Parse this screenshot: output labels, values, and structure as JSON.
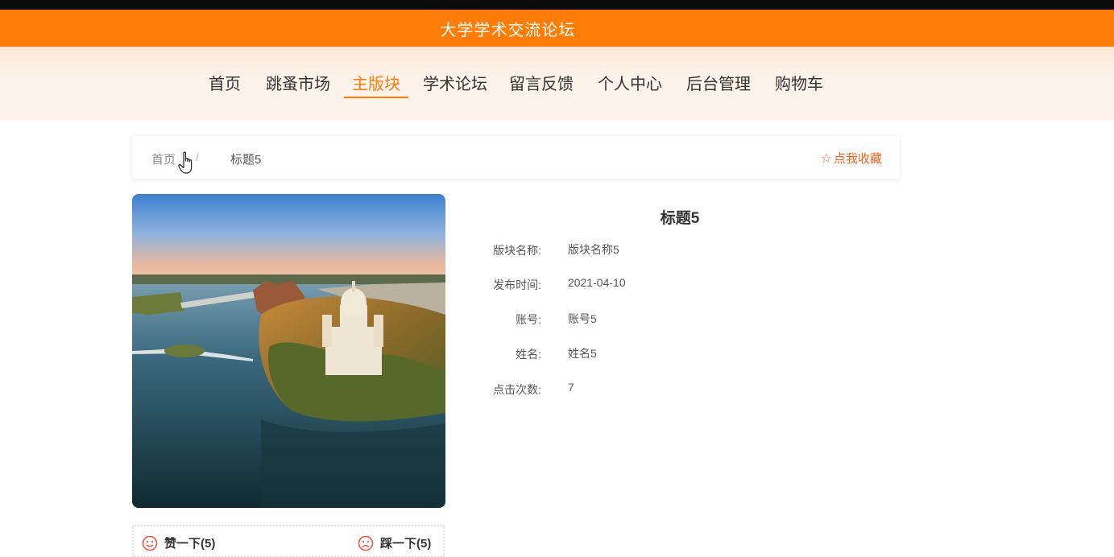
{
  "header": {
    "site_title": "大学学术交流论坛",
    "accent_color": "#ff7d06"
  },
  "nav": {
    "items": [
      {
        "label": "首页",
        "active": false
      },
      {
        "label": "跳蚤市场",
        "active": false
      },
      {
        "label": "主版块",
        "active": true
      },
      {
        "label": "学术论坛",
        "active": false
      },
      {
        "label": "留言反馈",
        "active": false
      },
      {
        "label": "个人中心",
        "active": false
      },
      {
        "label": "后台管理",
        "active": false
      },
      {
        "label": "购物车",
        "active": false
      }
    ]
  },
  "breadcrumb": {
    "home": "首页",
    "separator": "/",
    "current": "标题5"
  },
  "favorite": {
    "icon": "star-outline-icon",
    "label": "点我收藏"
  },
  "detail": {
    "title": "标题5",
    "rows": [
      {
        "label": "版块名称:",
        "value": "版块名称5"
      },
      {
        "label": "发布时间:",
        "value": "2021-04-10"
      },
      {
        "label": "账号:",
        "value": "账号5"
      },
      {
        "label": "姓名:",
        "value": "姓名5"
      },
      {
        "label": "点击次数:",
        "value": "7"
      }
    ]
  },
  "votes": {
    "like_label": "赞一下(5)",
    "dislike_label": "踩一下(5)"
  }
}
